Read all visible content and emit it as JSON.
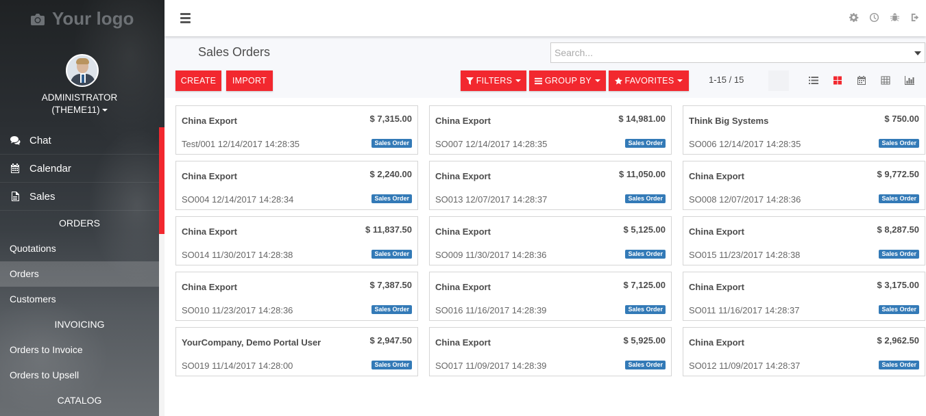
{
  "sidebar": {
    "logo_text": "Your logo",
    "user_line1": "ADMINISTRATOR",
    "user_line2": "(THEME11)",
    "menu": [
      {
        "label": "Chat",
        "icon": "chat-icon"
      },
      {
        "label": "Calendar",
        "icon": "calendar-icon"
      },
      {
        "label": "Sales",
        "icon": "document-icon"
      }
    ],
    "sections": {
      "orders": "ORDERS",
      "invoicing": "INVOICING",
      "catalog": "CATALOG"
    },
    "items": {
      "quotations": "Quotations",
      "orders": "Orders",
      "customers": "Customers",
      "orders_to_invoice": "Orders to Invoice",
      "orders_to_upsell": "Orders to Upsell"
    },
    "accent_color": "#f2282f"
  },
  "topbar": {
    "icons": [
      "gear-icon",
      "clock-icon",
      "bug-icon",
      "logout-icon"
    ]
  },
  "control": {
    "title": "Sales Orders",
    "search_placeholder": "Search...",
    "create": "CREATE",
    "import": "IMPORT",
    "filters": "FILTERS",
    "group_by": "GROUP BY",
    "favorites": "FAVORITES",
    "pager": "1-15 / 15",
    "views": [
      "list-view-icon",
      "kanban-view-icon",
      "calendar-view-icon",
      "pivot-view-icon",
      "graph-view-icon"
    ],
    "active_view": "kanban-view-icon"
  },
  "badge_label": "Sales Order",
  "badge_color": "#337ab7",
  "orders": [
    {
      "customer": "China Export",
      "amount": "$ 7,315.00",
      "ref": "Test/001 12/14/2017 14:28:35"
    },
    {
      "customer": "China Export",
      "amount": "$ 14,981.00",
      "ref": "SO007 12/14/2017 14:28:35"
    },
    {
      "customer": "Think Big Systems",
      "amount": "$ 750.00",
      "ref": "SO006 12/14/2017 14:28:35"
    },
    {
      "customer": "China Export",
      "amount": "$ 2,240.00",
      "ref": "SO004 12/14/2017 14:28:34"
    },
    {
      "customer": "China Export",
      "amount": "$ 11,050.00",
      "ref": "SO013 12/07/2017 14:28:37"
    },
    {
      "customer": "China Export",
      "amount": "$ 9,772.50",
      "ref": "SO008 12/07/2017 14:28:36"
    },
    {
      "customer": "China Export",
      "amount": "$ 11,837.50",
      "ref": "SO014 11/30/2017 14:28:38"
    },
    {
      "customer": "China Export",
      "amount": "$ 5,125.00",
      "ref": "SO009 11/30/2017 14:28:36"
    },
    {
      "customer": "China Export",
      "amount": "$ 8,287.50",
      "ref": "SO015 11/23/2017 14:28:38"
    },
    {
      "customer": "China Export",
      "amount": "$ 7,387.50",
      "ref": "SO010 11/23/2017 14:28:36"
    },
    {
      "customer": "China Export",
      "amount": "$ 7,125.00",
      "ref": "SO016 11/16/2017 14:28:39"
    },
    {
      "customer": "China Export",
      "amount": "$ 3,175.00",
      "ref": "SO011 11/16/2017 14:28:37"
    },
    {
      "customer": "YourCompany, Demo Portal User",
      "amount": "$ 2,947.50",
      "ref": "SO019 11/14/2017 14:28:00"
    },
    {
      "customer": "China Export",
      "amount": "$ 5,925.00",
      "ref": "SO017 11/09/2017 14:28:39"
    },
    {
      "customer": "China Export",
      "amount": "$ 2,962.50",
      "ref": "SO012 11/09/2017 14:28:37"
    }
  ]
}
